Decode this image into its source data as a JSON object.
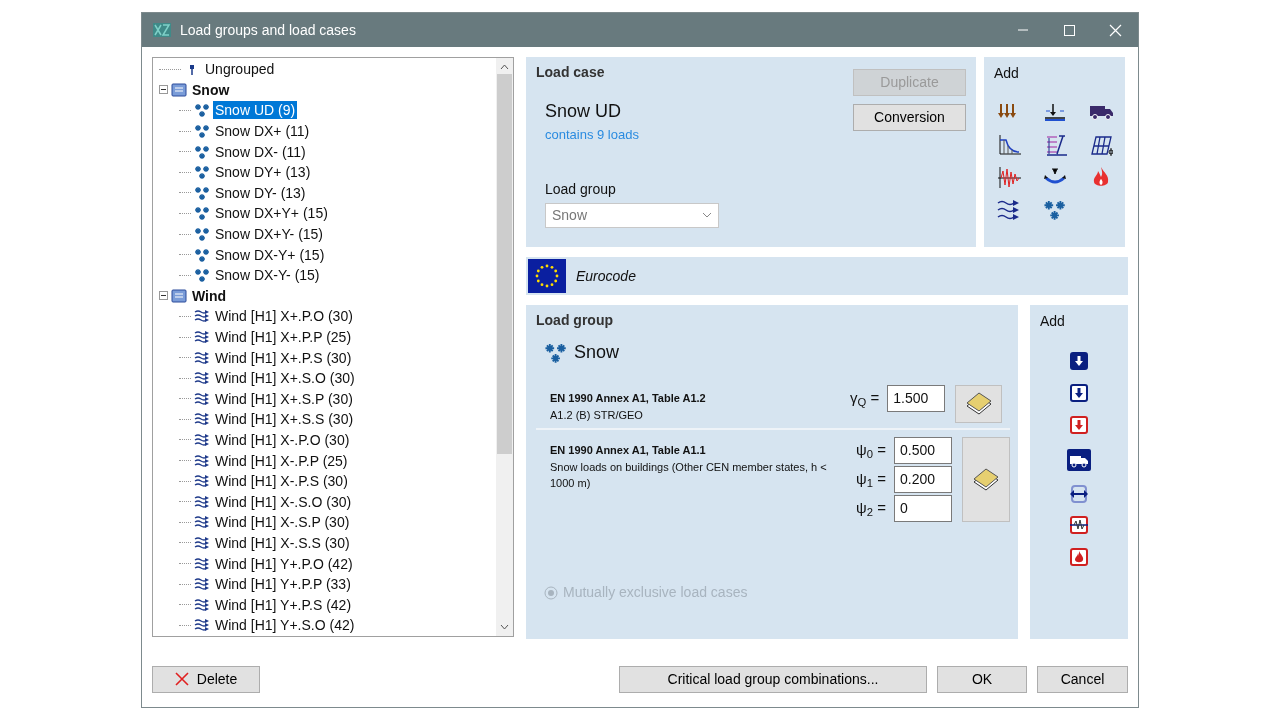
{
  "window": {
    "title": "Load groups and load cases"
  },
  "tree": [
    {
      "label": "Ungrouped",
      "kind": "ungrouped",
      "selected": false
    },
    {
      "label": "Snow",
      "kind": "group",
      "expanded": true,
      "selected": false,
      "children": [
        {
          "label": "Snow UD (9)",
          "kind": "snow",
          "selected": true
        },
        {
          "label": "Snow DX+ (11)",
          "kind": "snow",
          "selected": false
        },
        {
          "label": "Snow DX- (11)",
          "kind": "snow",
          "selected": false
        },
        {
          "label": "Snow DY+ (13)",
          "kind": "snow",
          "selected": false
        },
        {
          "label": "Snow DY- (13)",
          "kind": "snow",
          "selected": false
        },
        {
          "label": "Snow DX+Y+ (15)",
          "kind": "snow",
          "selected": false
        },
        {
          "label": "Snow DX+Y- (15)",
          "kind": "snow",
          "selected": false
        },
        {
          "label": "Snow DX-Y+ (15)",
          "kind": "snow",
          "selected": false
        },
        {
          "label": "Snow DX-Y- (15)",
          "kind": "snow",
          "selected": false
        }
      ]
    },
    {
      "label": "Wind",
      "kind": "group",
      "expanded": true,
      "selected": false,
      "children": [
        {
          "label": "Wind [H1] X+.P.O (30)",
          "kind": "wind",
          "selected": false
        },
        {
          "label": "Wind [H1] X+.P.P (25)",
          "kind": "wind",
          "selected": false
        },
        {
          "label": "Wind [H1] X+.P.S (30)",
          "kind": "wind",
          "selected": false
        },
        {
          "label": "Wind [H1] X+.S.O (30)",
          "kind": "wind",
          "selected": false
        },
        {
          "label": "Wind [H1] X+.S.P (30)",
          "kind": "wind",
          "selected": false
        },
        {
          "label": "Wind [H1] X+.S.S (30)",
          "kind": "wind",
          "selected": false
        },
        {
          "label": "Wind [H1] X-.P.O (30)",
          "kind": "wind",
          "selected": false
        },
        {
          "label": "Wind [H1] X-.P.P (25)",
          "kind": "wind",
          "selected": false
        },
        {
          "label": "Wind [H1] X-.P.S (30)",
          "kind": "wind",
          "selected": false
        },
        {
          "label": "Wind [H1] X-.S.O (30)",
          "kind": "wind",
          "selected": false
        },
        {
          "label": "Wind [H1] X-.S.P (30)",
          "kind": "wind",
          "selected": false
        },
        {
          "label": "Wind [H1] X-.S.S (30)",
          "kind": "wind",
          "selected": false
        },
        {
          "label": "Wind [H1] Y+.P.O (42)",
          "kind": "wind",
          "selected": false
        },
        {
          "label": "Wind [H1] Y+.P.P (33)",
          "kind": "wind",
          "selected": false
        },
        {
          "label": "Wind [H1] Y+.P.S (42)",
          "kind": "wind",
          "selected": false
        },
        {
          "label": "Wind [H1] Y+.S.O (42)",
          "kind": "wind",
          "selected": false
        }
      ]
    }
  ],
  "load_case": {
    "heading": "Load case",
    "name": "Snow UD",
    "loads_link": "contains 9 loads",
    "group_label": "Load group",
    "group_value": "Snow",
    "group_disabled": true,
    "buttons": [
      {
        "label": "Duplicate",
        "disabled": true
      },
      {
        "label": "Conversion",
        "disabled": false
      }
    ]
  },
  "add_load_heading": "Add",
  "code_bar": {
    "label": "Eurocode"
  },
  "load_group": {
    "heading": "Load group",
    "name": "Snow",
    "sections": [
      {
        "title": "EN 1990 Annex A1, Table A1.2",
        "subtitle": "A1.2 (B) STR/GEO",
        "fields": [
          {
            "label": "γ$_{Q}$ =",
            "value": "1.500"
          }
        ]
      },
      {
        "title": "EN 1990 Annex A1, Table A1.1",
        "subtitle": "Snow loads on buildings (Other CEN member states, h < 1000 m)",
        "fields": [
          {
            "label": "ψ$_{0}$ =",
            "value": "0.500"
          },
          {
            "label": "ψ$_{1}$ =",
            "value": "0.200"
          },
          {
            "label": "ψ$_{2}$ =",
            "value": "0"
          }
        ]
      }
    ],
    "option": {
      "label": "Mutually exclusive load cases",
      "selected": true,
      "disabled": true
    }
  },
  "add_group_heading": "Add",
  "footer_buttons": [
    {
      "label": "Delete",
      "kind": "delete"
    },
    {
      "label": "Critical load group combinations...",
      "kind": "plain"
    },
    {
      "label": "OK",
      "kind": "plain"
    },
    {
      "label": "Cancel",
      "kind": "plain"
    }
  ]
}
